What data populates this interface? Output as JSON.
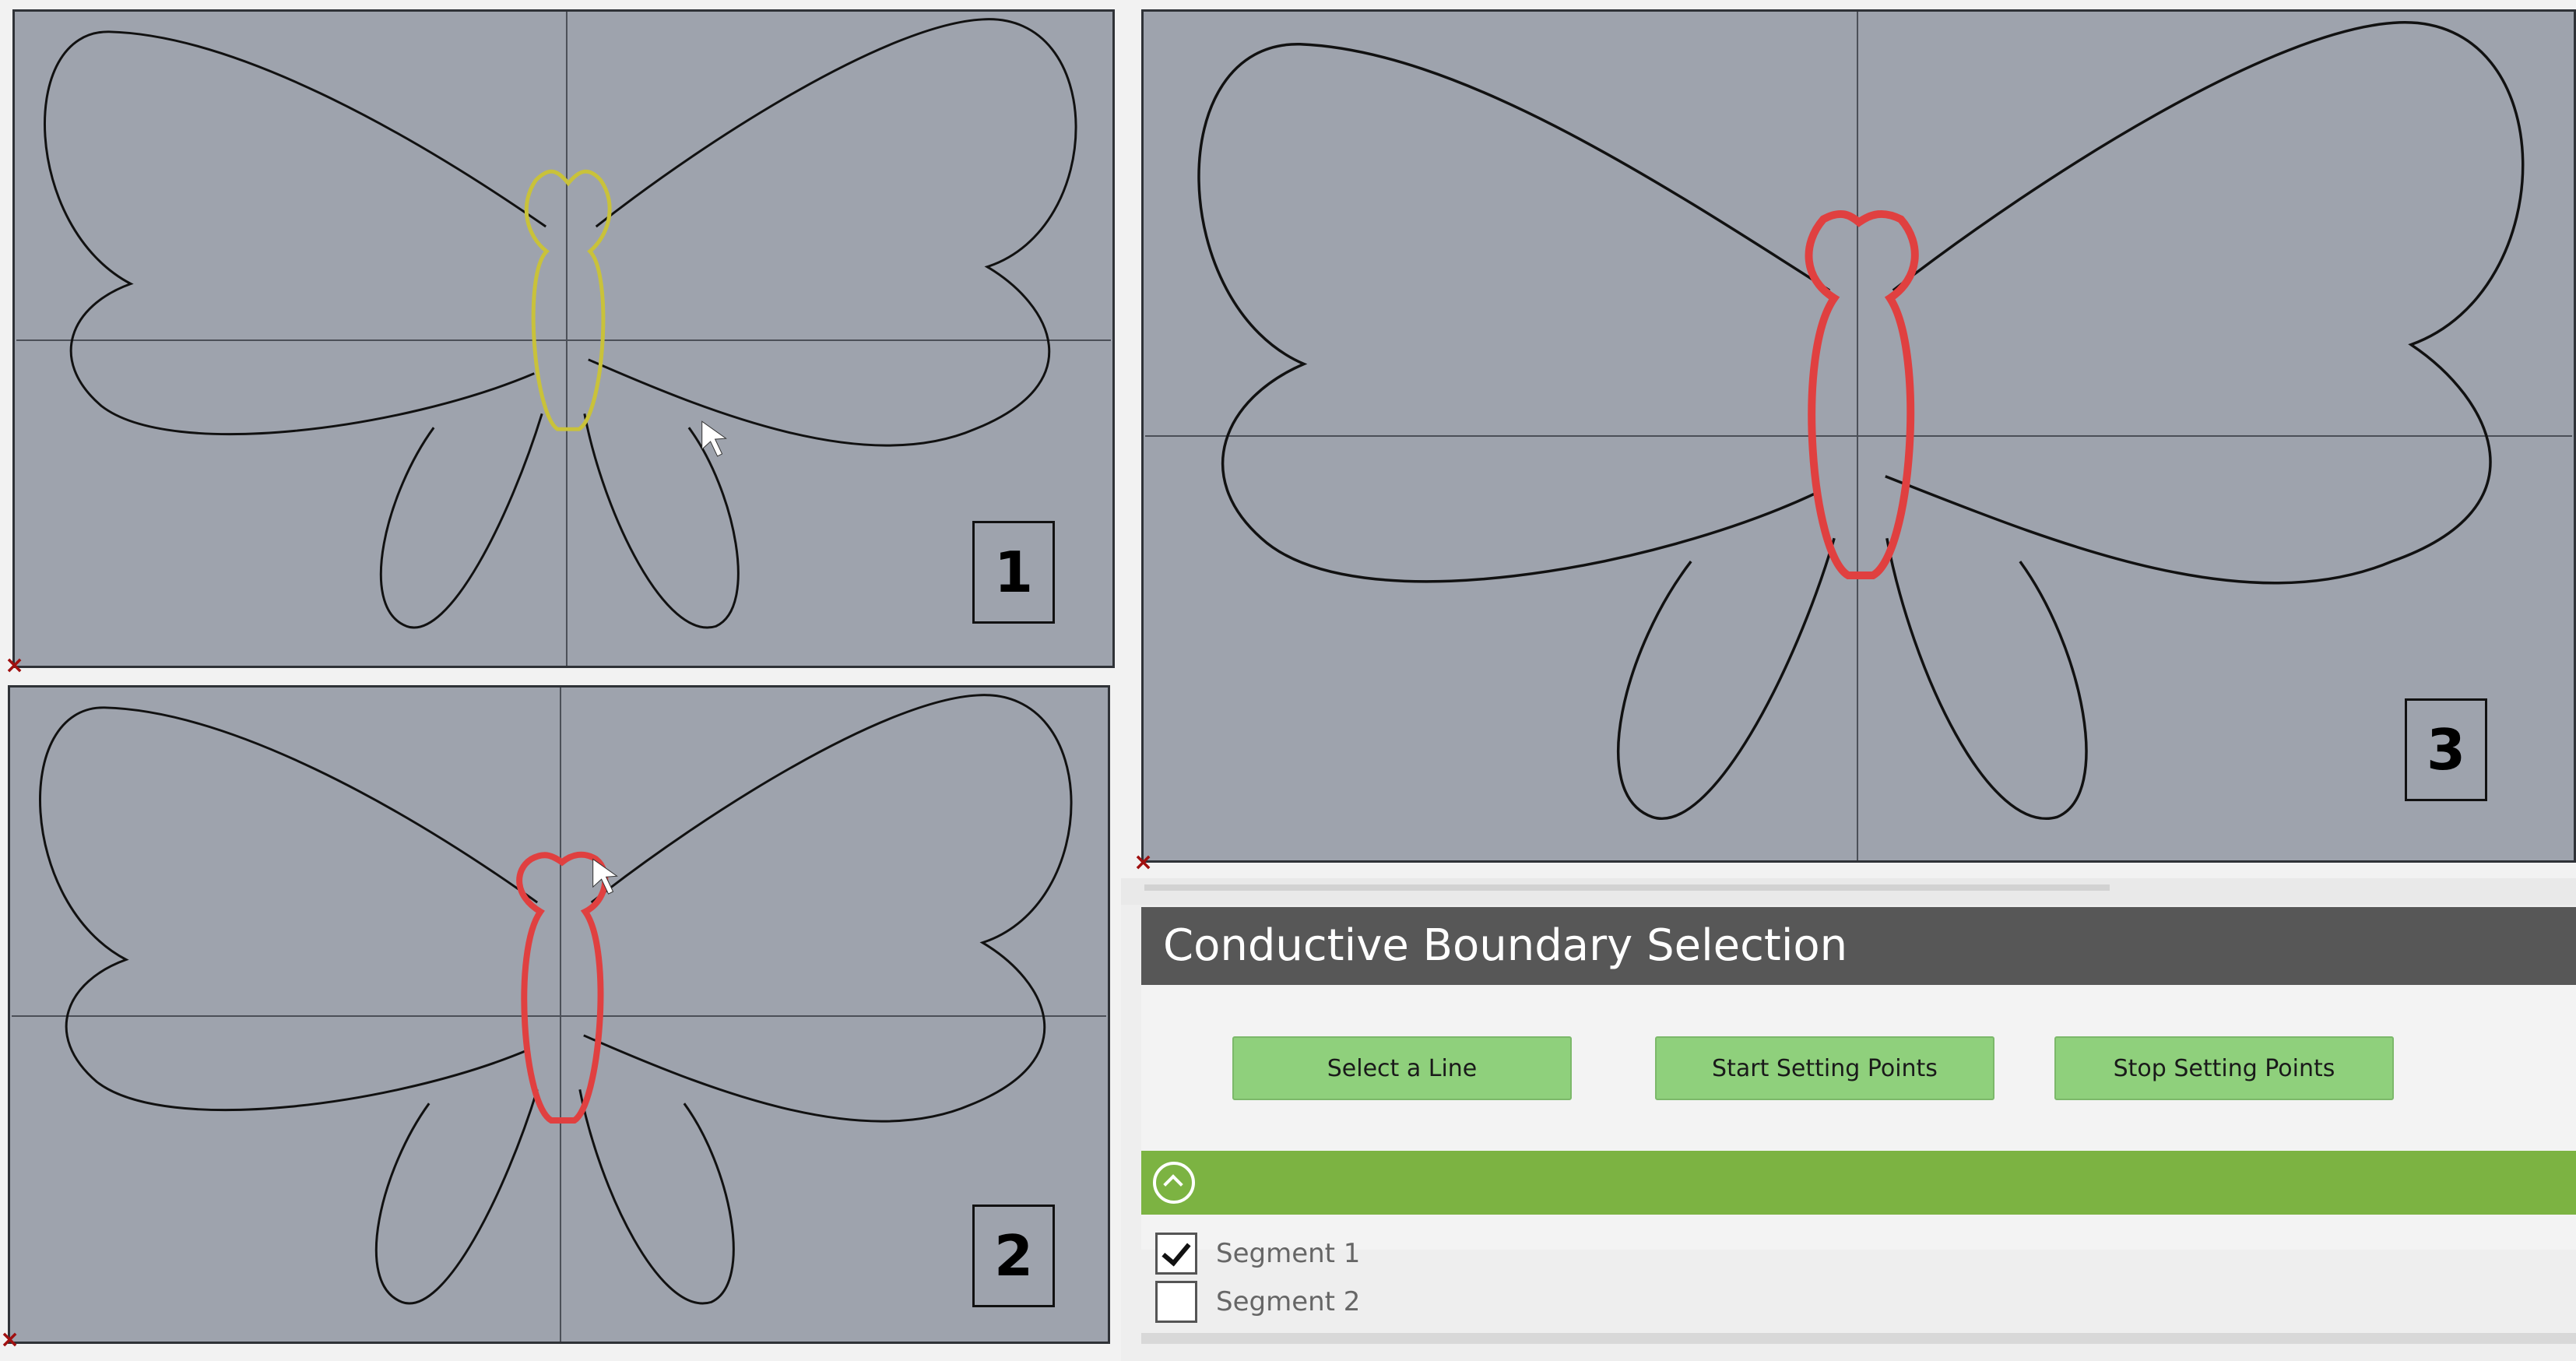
{
  "viewports": [
    {
      "label": "1",
      "highlight": "yellow-outline"
    },
    {
      "label": "2",
      "highlight": "red-outline"
    },
    {
      "label": "3",
      "highlight": "red-outline"
    }
  ],
  "origin_marker": "×",
  "panel": {
    "title": "Conductive Boundary Selection",
    "buttons": {
      "select_line": "Select a Line",
      "start_points": "Start Setting Points",
      "stop_points": "Stop Setting Points"
    },
    "segments": [
      {
        "label": "Segment 1",
        "checked": true
      },
      {
        "label": "Segment 2",
        "checked": false
      }
    ]
  },
  "colors": {
    "viewport_bg": "#9ea3ad",
    "highlight_yellow": "#c9c23a",
    "highlight_red": "#e04040",
    "header_bg": "#575757",
    "button_green": "#8fd07c",
    "bar_green": "#7cb342"
  }
}
